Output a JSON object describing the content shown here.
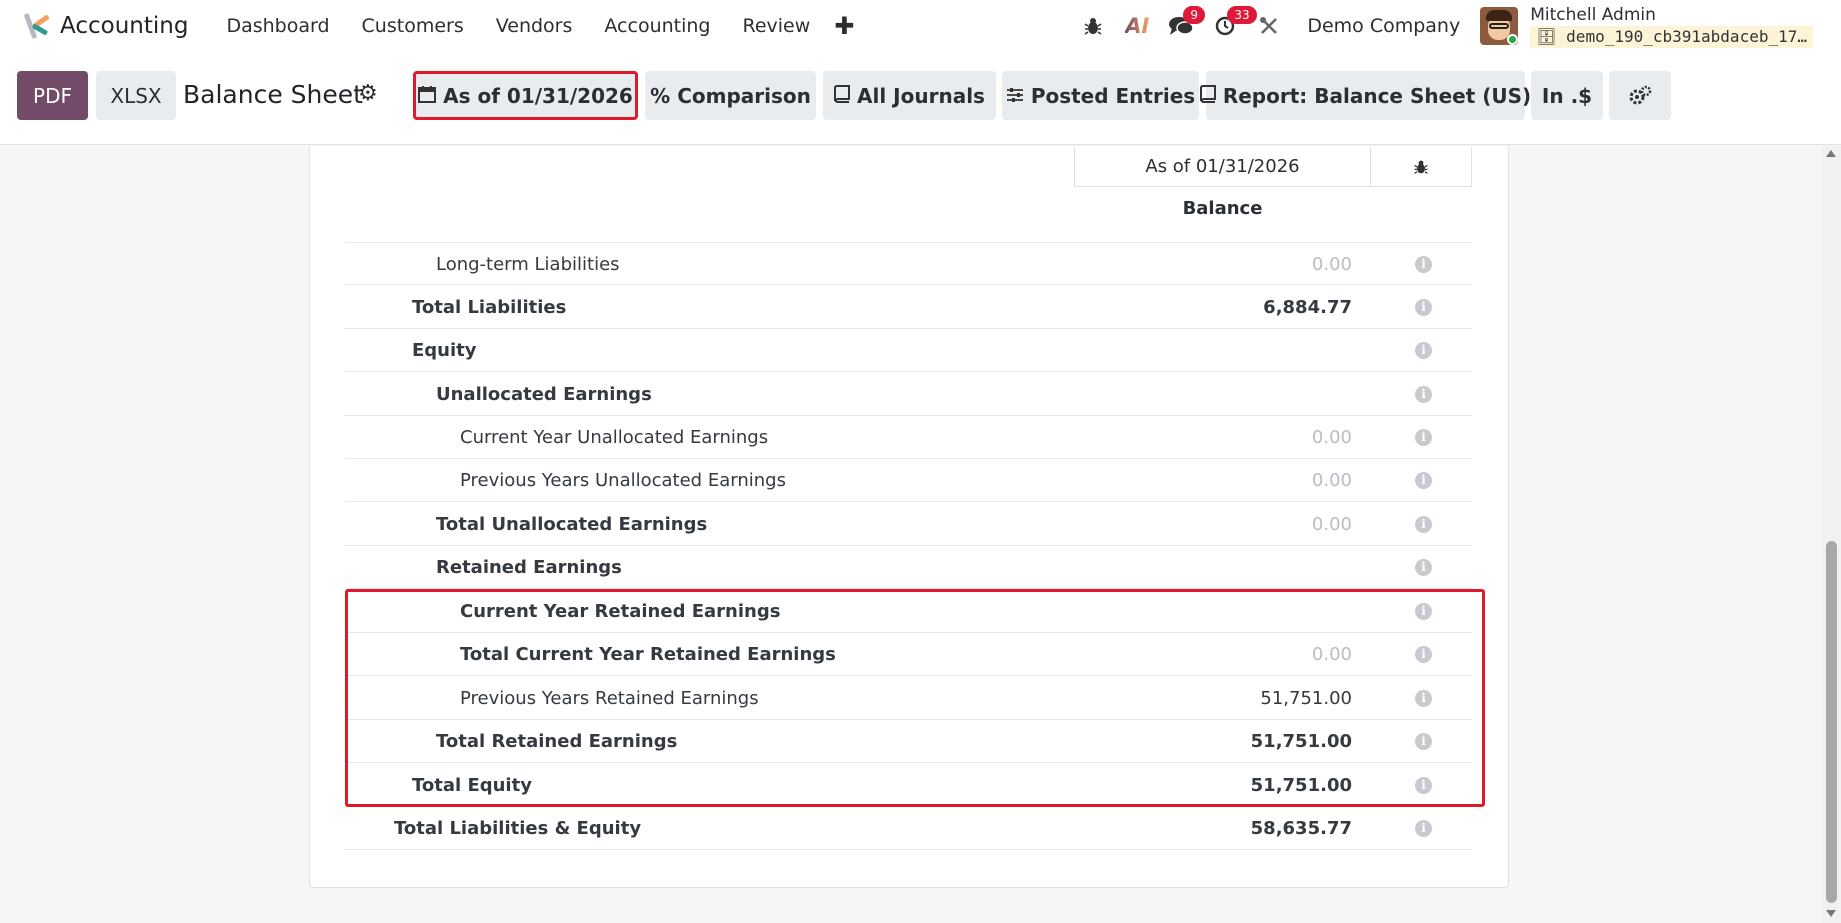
{
  "navbar": {
    "app_name": "Accounting",
    "menu": [
      "Dashboard",
      "Customers",
      "Vendors",
      "Accounting",
      "Review"
    ],
    "plus_label": "✚",
    "icons": [
      "bug-icon",
      "ai-icon",
      "chat-icon",
      "activity-clock-icon",
      "tools-icon"
    ],
    "ai_label": "AI",
    "chat_badge": "9",
    "activity_badge": "33",
    "company": "Demo Company",
    "user_name": "Mitchell Admin",
    "db_name": "demo_190_cb391abdaceb_17…"
  },
  "control": {
    "pdf_label": "PDF",
    "xlsx_label": "XLSX",
    "title": "Balance Sheet",
    "date_filter": "As of 01/31/2026",
    "comparison": "Comparison",
    "journals": "All Journals",
    "entries": "Posted Entries",
    "report_variant": "Report: Balance Sheet (US)",
    "currency": "In .$"
  },
  "report": {
    "column_header": "As of 01/31/2026",
    "column_sub": "Balance",
    "rows": [
      {
        "label": "Long-term Liabilities",
        "value": "0.00"
      },
      {
        "label": "Total Liabilities",
        "value": "6,884.77"
      },
      {
        "label": "Equity",
        "value": ""
      },
      {
        "label": "Unallocated Earnings",
        "value": ""
      },
      {
        "label": "Current Year Unallocated Earnings",
        "value": "0.00"
      },
      {
        "label": "Previous Years Unallocated Earnings",
        "value": "0.00"
      },
      {
        "label": "Total Unallocated Earnings",
        "value": "0.00"
      },
      {
        "label": "Retained Earnings",
        "value": ""
      },
      {
        "label": "Current Year Retained Earnings",
        "value": ""
      },
      {
        "label": "Total Current Year Retained Earnings",
        "value": "0.00"
      },
      {
        "label": "Previous Years Retained Earnings",
        "value": "51,751.00"
      },
      {
        "label": "Total Retained Earnings",
        "value": "51,751.00"
      },
      {
        "label": "Total Equity",
        "value": "51,751.00"
      },
      {
        "label": "Total Liabilities & Equity",
        "value": "58,635.77"
      }
    ]
  },
  "colors": {
    "primary": "#714b67",
    "highlight": "#e0192d",
    "badge": "#e0193a"
  }
}
